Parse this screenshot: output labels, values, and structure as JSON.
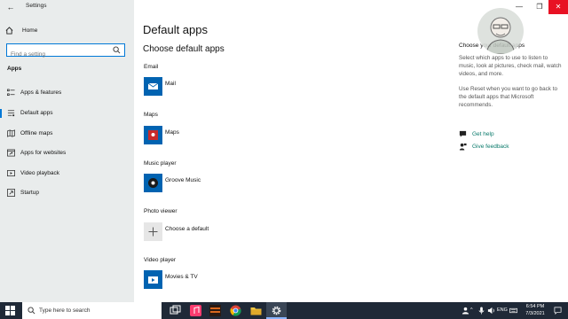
{
  "window": {
    "title": "Settings",
    "back_glyph": "←",
    "controls": {
      "minimize": "—",
      "maximize": "❐",
      "close": "✕"
    }
  },
  "sidebar": {
    "home_label": "Home",
    "search_placeholder": "Find a setting",
    "section": "Apps",
    "items": [
      {
        "label": "Apps & features",
        "icon": "list-icon",
        "selected": false
      },
      {
        "label": "Default apps",
        "icon": "default-apps-icon",
        "selected": true
      },
      {
        "label": "Offline maps",
        "icon": "map-icon",
        "selected": false
      },
      {
        "label": "Apps for websites",
        "icon": "web-link-icon",
        "selected": false
      },
      {
        "label": "Video playback",
        "icon": "video-icon",
        "selected": false
      },
      {
        "label": "Startup",
        "icon": "startup-icon",
        "selected": false
      }
    ]
  },
  "main": {
    "title": "Default apps",
    "subtitle": "Choose default apps",
    "categories": [
      {
        "label": "Email",
        "app": "Mail",
        "icon": "mail-icon"
      },
      {
        "label": "Maps",
        "app": "Maps",
        "icon": "maps-app-icon"
      },
      {
        "label": "Music player",
        "app": "Groove Music",
        "icon": "groove-music-icon"
      },
      {
        "label": "Photo viewer",
        "app": "Choose a default",
        "icon": "plus-icon"
      },
      {
        "label": "Video player",
        "app": "Movies & TV",
        "icon": "movies-tv-icon"
      }
    ]
  },
  "info": {
    "title": "Choose your default apps",
    "paragraph1": "Select which apps to use to listen to music, look at pictures, check mail, watch videos, and more.",
    "paragraph2": "Use Reset when you want to go back to the default apps that Microsoft recommends.",
    "links": [
      {
        "label": "Get help",
        "icon": "help-chat-icon"
      },
      {
        "label": "Give feedback",
        "icon": "feedback-icon"
      }
    ]
  },
  "taskbar": {
    "search_placeholder": "Type here to search",
    "language": "ENG",
    "time": "6:54 PM",
    "date": "7/3/2021"
  },
  "colors": {
    "accent": "#0078d7",
    "link": "#0a7a6b",
    "sidebar_bg": "#e9ecec",
    "taskbar_bg": "#1f2937",
    "close_red": "#e81123"
  }
}
